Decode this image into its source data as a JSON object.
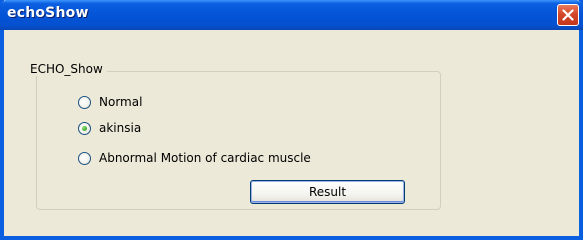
{
  "window": {
    "title": "echoShow",
    "accent_color": "#0a5fe0"
  },
  "groupbox": {
    "label": "ECHO_Show"
  },
  "options": [
    {
      "label": "Normal",
      "selected": false
    },
    {
      "label": "akinsia",
      "selected": true
    },
    {
      "label": "Abnormal Motion of cardiac muscle",
      "selected": false
    }
  ],
  "buttons": {
    "result_label": "Result"
  },
  "icons": {
    "close": "close-icon"
  }
}
